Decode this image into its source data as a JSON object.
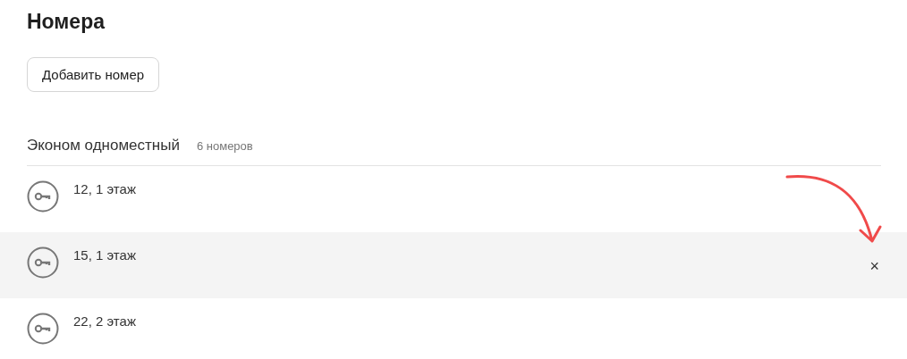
{
  "title": "Номера",
  "add_button": "Добавить номер",
  "group": {
    "name": "Эконом одноместный",
    "count": "6 номеров"
  },
  "remove_button": "×",
  "rooms": [
    {
      "label": "12, 1 этаж",
      "highlighted": false
    },
    {
      "label": "15, 1 этаж",
      "highlighted": true
    },
    {
      "label": "22, 2 этаж",
      "highlighted": false
    }
  ]
}
